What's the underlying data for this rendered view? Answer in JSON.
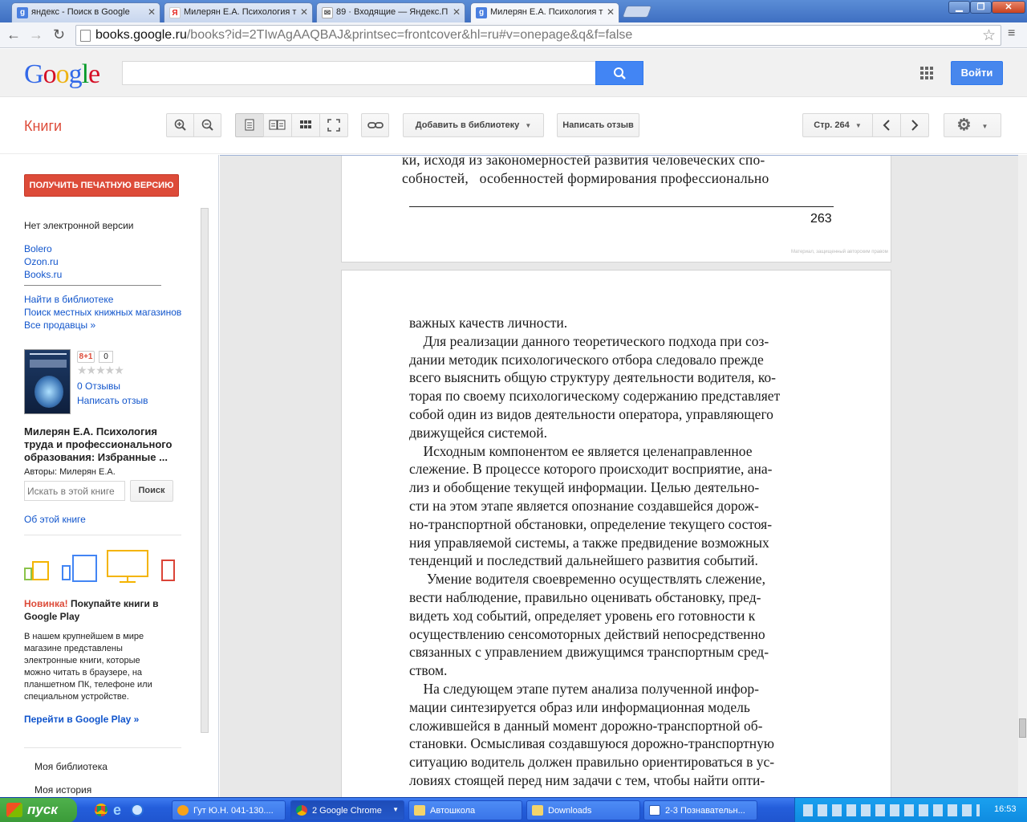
{
  "browser": {
    "tabs": [
      {
        "label": "яндекс - Поиск в Google",
        "favicon": "google-g"
      },
      {
        "label": "Милерян Е.А. Психология т",
        "favicon": "yandex-y"
      },
      {
        "label": "89 · Входящие — Яндекс.П",
        "favicon": "mail-envelope"
      },
      {
        "label": "Милерян Е.А. Психология т",
        "favicon": "google-g"
      }
    ],
    "url_host": "books.google.ru",
    "url_rest": "/books?id=2TIwAgAAQBAJ&printsec=frontcover&hl=ru#v=onepage&q&f=false"
  },
  "google": {
    "logo_letters": [
      "G",
      "o",
      "o",
      "g",
      "l",
      "e"
    ],
    "logo_colors": [
      "#3369e8",
      "#d50f25",
      "#eeb211",
      "#3369e8",
      "#009925",
      "#d50f25"
    ],
    "signin_label": "Войти"
  },
  "books_toolbar": {
    "section_label": "Книги",
    "add_to_library_label": "Добавить в библиотеку",
    "write_review_label": "Написать отзыв",
    "page_label": "Стр. 264"
  },
  "sidebar": {
    "print_button_label": "ПОЛУЧИТЬ ПЕЧАТНУЮ ВЕРСИЮ",
    "no_ebook_label": "Нет электронной версии",
    "sellers": [
      "Bolero",
      "Ozon.ru",
      "Books.ru"
    ],
    "find_in_library": "Найти в библиотеке",
    "local_stores": "Поиск местных книжных магазинов",
    "all_sellers": "Все продавцы »",
    "gplus_label": "8+1",
    "gplus_count": "0",
    "reviews_count": "0 Отзывы",
    "write_review": "Написать отзыв",
    "book_title_lines": [
      "Милерян Е.А. Психология",
      "труда и профессионального",
      "образования: Избранные ..."
    ],
    "authors": "Авторы: Милерян Е.А.",
    "search_placeholder": "Искать в этой книге",
    "search_button": "Поиск",
    "about_book": "Об этой книге",
    "promo_new": "Новинка!",
    "promo_title_rest": " Покупайте книги в",
    "promo_title_line2": "Google Play",
    "promo_body_lines": [
      "В нашем крупнейшем в мире",
      "магазине представлены",
      "электронные книги, которые",
      "можно читать в браузере, на",
      "планшетном ПК, телефоне или",
      "специальном устройстве."
    ],
    "promo_link": "Перейти в Google Play »",
    "my_library": "Моя библиотека",
    "my_history": "Моя история"
  },
  "reader": {
    "page_263_lines": [
      "ки, исходя из закономерностей развития человеческих спо-",
      "собностей,   особенностей формирования профессионально"
    ],
    "page_263_number": "263",
    "page_263_copyright": "Материал, защищенный авторским правом",
    "page_264_text": "важных качеств личности.\n    Для реализации данного теоретического подхода при соз-\nдании методик психологического отбора следовало прежде\nвсего выяснить общую структуру деятельности водителя, ко-\nторая по своему психологическому содержанию представляет\nсобой один из видов деятельности оператора, управляющего\nдвижущейся системой.\n    Исходным компонентом ее является целенаправленное\nслежение. В процессе которого происходит восприятие, ана-\nлиз и обобщение текущей информации. Целью деятельно-\nсти на этом этапе является опознание создавшейся дорож-\nно-транспортной обстановки, определение текущего состоя-\nния управляемой системы, а также предвидение возможных\nтенденций и последствий дальнейшего развития событий.\n     Умение водителя своевременно осуществлять слежение,\nвести наблюдение, правильно оценивать обстановку, пред-\nвидеть ход событий, определяет уровень его готовности к\nосуществлению сенсомоторных действий непосредственно\nсвязанных с управлением движущимся транспортным сред-\nством.\n    На следующем этапе путем анализа полученной инфор-\nмации синтезируется образ или информационная модель\nсложившейся в данный момент дорожно-транспортной об-\nстановки. Осмысливая создавшуюся дорожно-транспортную\nситуацию водитель должен правильно ориентироваться в ус-\nловиях стоящей перед ним задачи с тем, чтобы найти опти-"
  },
  "taskbar": {
    "start_label": "пуск",
    "tasks": [
      "Гут Ю.Н. 041-130....",
      "2 Google Chrome",
      "Автошкола",
      "Downloads",
      "2-3 Познавательн..."
    ],
    "clock": "16:53"
  }
}
